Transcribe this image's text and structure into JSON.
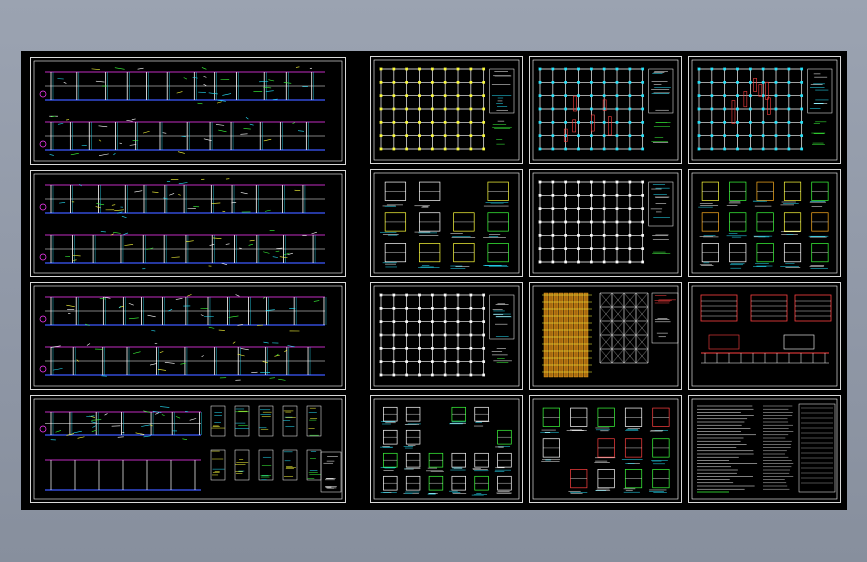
{
  "canvas": {
    "background": "#000000",
    "frame": "#d8d8d8"
  },
  "palette": {
    "white": "#ffffff",
    "cyan": "#27e6ff",
    "green": "#3cff3c",
    "yellow": "#ffff3c",
    "magenta": "#ff3cff",
    "red": "#ff4040",
    "blue": "#3c5aff",
    "orange": "#ffb020"
  },
  "sheets": [
    {
      "type": "elevation"
    },
    {
      "type": "elevation"
    },
    {
      "type": "elevation"
    },
    {
      "type": "elevation-details"
    },
    {
      "type": "plan-yellow"
    },
    {
      "type": "plan-cyan-red"
    },
    {
      "type": "plan-cyan-red"
    },
    {
      "type": "details-yellow"
    },
    {
      "type": "plan-grid"
    },
    {
      "type": "details-mixed"
    },
    {
      "type": "plan-grid"
    },
    {
      "type": "plan-orange"
    },
    {
      "type": "sections-red"
    },
    {
      "type": "details-green"
    },
    {
      "type": "details-sparse"
    },
    {
      "type": "notes"
    }
  ]
}
